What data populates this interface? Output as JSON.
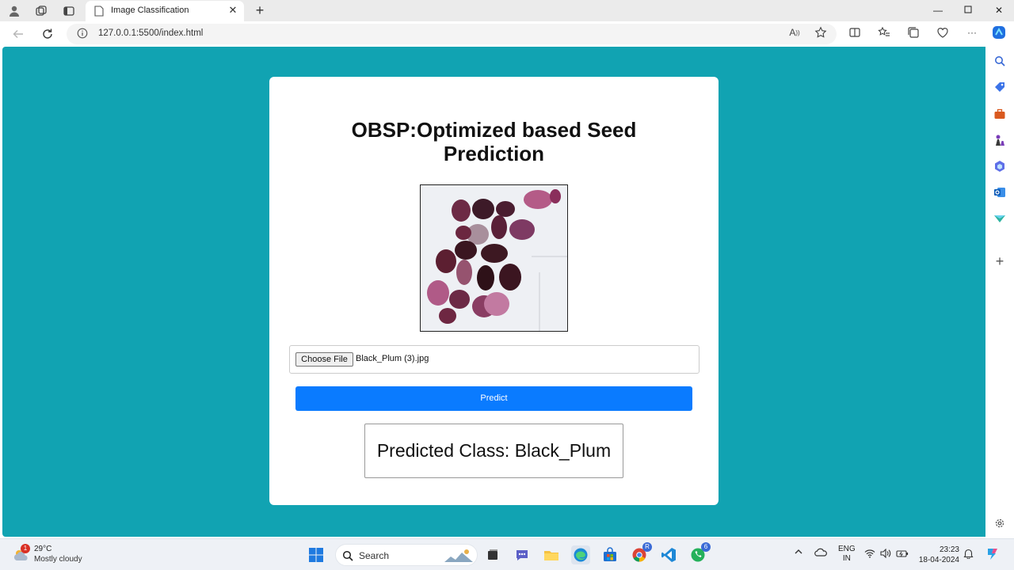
{
  "browser": {
    "tab_title": "Image Classification",
    "url": "127.0.0.1:5500/index.html"
  },
  "page": {
    "title": "OBSP:Optimized based Seed Prediction",
    "choose_file_label": "Choose File",
    "file_name": "Black_Plum (3).jpg",
    "predict_label": "Predict",
    "result_text": "Predicted Class: Black_Plum",
    "background_color": "#11a3b2",
    "button_color": "#0a7bff"
  },
  "taskbar": {
    "weather_temp": "29°C",
    "weather_desc": "Mostly cloudy",
    "weather_badge": "1",
    "search_label": "Search",
    "chrome_badge": "R",
    "whatsapp_badge": "6",
    "lang_top": "ENG",
    "lang_bottom": "IN",
    "time": "23:23",
    "date": "18-04-2024"
  }
}
